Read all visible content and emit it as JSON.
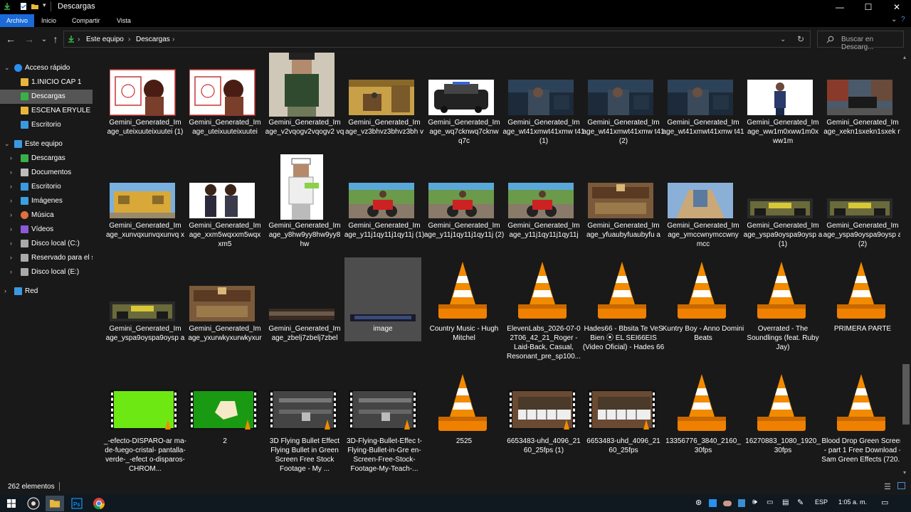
{
  "window": {
    "title": "Descargas",
    "controls": [
      "—",
      "☐",
      "✕"
    ]
  },
  "ribbon": {
    "tabs": [
      "Archivo",
      "Inicio",
      "Compartir",
      "Vista"
    ]
  },
  "address": {
    "crumbs": [
      "Este equipo",
      "Descargas"
    ],
    "search_placeholder": "Buscar en Descarg..."
  },
  "nav": {
    "items": [
      {
        "label": "Acceso rápido",
        "icon": "star-icon",
        "level": 0,
        "chevron": "⌄"
      },
      {
        "label": "1.INICIO CAP 1",
        "icon": "folder-icon",
        "level": 1
      },
      {
        "label": "Descargas",
        "icon": "download-icon",
        "level": 1,
        "selected": true
      },
      {
        "label": "ESCENA ERYULE DIS",
        "icon": "folder-icon",
        "level": 1
      },
      {
        "label": "Escritorio",
        "icon": "desktop-icon",
        "level": 1
      },
      {
        "label": "Este equipo",
        "icon": "computer-icon",
        "level": 0,
        "chevron": "⌄"
      },
      {
        "label": "Descargas",
        "icon": "download-icon",
        "level": 1,
        "chevron": "›"
      },
      {
        "label": "Documentos",
        "icon": "documents-icon",
        "level": 1,
        "chevron": "›"
      },
      {
        "label": "Escritorio",
        "icon": "desktop-icon",
        "level": 1,
        "chevron": "›"
      },
      {
        "label": "Imágenes",
        "icon": "images-icon",
        "level": 1,
        "chevron": "›"
      },
      {
        "label": "Música",
        "icon": "music-icon",
        "level": 1,
        "chevron": "›"
      },
      {
        "label": "Vídeos",
        "icon": "videos-icon",
        "level": 1,
        "chevron": "›"
      },
      {
        "label": "Disco local (C:)",
        "icon": "drive-icon",
        "level": 1,
        "chevron": "›"
      },
      {
        "label": "Reservado para el si",
        "icon": "drive-icon",
        "level": 1,
        "chevron": "›"
      },
      {
        "label": "Disco local (E:)",
        "icon": "drive-icon",
        "level": 1,
        "chevron": "›"
      },
      {
        "label": "Red",
        "icon": "network-icon",
        "level": 0,
        "chevron": "›"
      }
    ]
  },
  "files": [
    [
      {
        "label": "Gemini_Generated_Im age_uteixuuteixuutei (1)",
        "kind": "sketch"
      },
      {
        "label": "Gemini_Generated_Im age_uteixuuteixuutei",
        "kind": "sketch"
      },
      {
        "label": "Gemini_Generated_Im age_v2vqogv2vqogv2 vq",
        "kind": "portrait-tall"
      },
      {
        "label": "Gemini_Generated_Im age_vz3bhvz3bhvz3bh v",
        "kind": "room"
      },
      {
        "label": "Gemini_Generated_Im age_wq7cknwq7cknw q7c",
        "kind": "car"
      },
      {
        "label": "Gemini_Generated_Im age_wt41xmwt41xmw t41 (1)",
        "kind": "dark-scene"
      },
      {
        "label": "Gemini_Generated_Im age_wt41xmwt41xmw t41 (2)",
        "kind": "dark-scene"
      },
      {
        "label": "Gemini_Generated_Im age_wt41xmwt41xmw t41",
        "kind": "dark-scene"
      },
      {
        "label": "Gemini_Generated_Im age_ww1m0xww1m0x ww1m",
        "kind": "figure-white"
      },
      {
        "label": "Gemini_Generated_Im age_xekn1sxekn1sxek n",
        "kind": "street"
      }
    ],
    [
      {
        "label": "Gemini_Generated_Im age_xunvqxunvqxunvq x",
        "kind": "building"
      },
      {
        "label": "Gemini_Generated_Im age_xxm5wqxxm5wqx xm5",
        "kind": "figures-white"
      },
      {
        "label": "Gemini_Generated_Im age_y8hw9yy8hw9yy8 hw",
        "kind": "portrait-tall-white"
      },
      {
        "label": "Gemini_Generated_Im age_y11j1qy11j1qy11j (1)",
        "kind": "moto"
      },
      {
        "label": "Gemini_Generated_Im age_y11j1qy11j1qy11j (2)",
        "kind": "moto"
      },
      {
        "label": "Gemini_Generated_Im age_y11j1qy11j1qy11j",
        "kind": "moto"
      },
      {
        "label": "Gemini_Generated_Im age_yfuaubyfuaubyfu a",
        "kind": "shop"
      },
      {
        "label": "Gemini_Generated_Im age_ymccwnymccwny mcc",
        "kind": "hallway"
      },
      {
        "label": "Gemini_Generated_Im age_yspa9oyspa9oysp a (1)",
        "kind": "storefront"
      },
      {
        "label": "Gemini_Generated_Im age_yspa9oyspa9oysp a (2)",
        "kind": "storefront"
      }
    ],
    [
      {
        "label": "Gemini_Generated_Im age_yspa9oyspa9oysp a",
        "kind": "storefront"
      },
      {
        "label": "Gemini_Generated_Im age_yxurwkyxurwkyxur",
        "kind": "shop"
      },
      {
        "label": "Gemini_Generated_Im age_zbelj7zbelj7zbel",
        "kind": "strip"
      },
      {
        "label": "image",
        "kind": "image-selected"
      },
      {
        "label": "Country Music - Hugh Mitchel",
        "kind": "vlc"
      },
      {
        "label": "ElevenLabs_2026-07-0 2T06_42_21_Roger - Laid-Back, Casual, Resonant_pre_sp100...",
        "kind": "vlc"
      },
      {
        "label": "Hades66 - Bbsita Te VeS Bien ⦿ EL SEI66EIS (Video Oficial) - Hades 66",
        "kind": "vlc"
      },
      {
        "label": "Kuntry Boy - Anno Domini Beats",
        "kind": "vlc"
      },
      {
        "label": "Overrated - The Soundlings (feat. Ruby Jay)",
        "kind": "vlc"
      },
      {
        "label": "PRIMERA PARTE",
        "kind": "vlc"
      }
    ],
    [
      {
        "label": "_-efecto-DISPARO-ar ma-de-fuego-cristal- pantalla-verde-_-efect o-disparos-CHROM...",
        "kind": "video-green"
      },
      {
        "label": "2",
        "kind": "video-green2"
      },
      {
        "label": "3D Flying  Bullet Effect  Flying Bullet in Green Screen Free Stock Footage - My ...",
        "kind": "video-bullet"
      },
      {
        "label": "3D-Flying-Bullet-Effec t-Flying-Bullet-in-Gre en-Screen-Free-Stock- Footage-My-Teach-...",
        "kind": "video-bullet"
      },
      {
        "label": "2525",
        "kind": "vlc"
      },
      {
        "label": "6653483-uhd_4096_21 60_25fps (1)",
        "kind": "video-piano"
      },
      {
        "label": "6653483-uhd_4096_21 60_25fps",
        "kind": "video-piano"
      },
      {
        "label": "13356776_3840_2160_ 30fps",
        "kind": "vlc"
      },
      {
        "label": "16270883_1080_1920_ 30fps",
        "kind": "vlc"
      },
      {
        "label": "Blood Drop Green Screen - part 1 Free Download - Sam Green Effects (720...",
        "kind": "vlc"
      }
    ]
  ],
  "status": {
    "count": "262 elementos"
  },
  "taskbar": {
    "lang": "ESP",
    "time": "1:05 a. m."
  },
  "colors": {
    "accent": "#1a6ad9",
    "selected_nav": "#555555",
    "folder": "#e8b63a",
    "vlc_orange": "#f28b00"
  }
}
